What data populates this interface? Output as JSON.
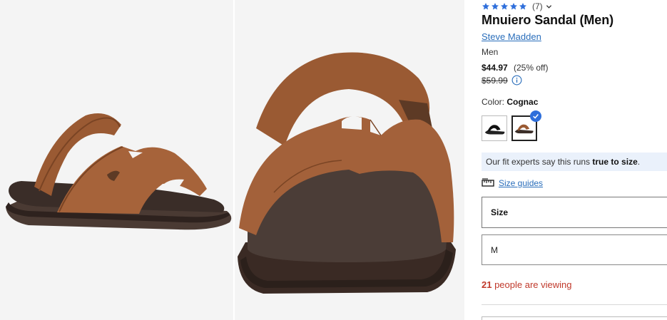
{
  "rating": {
    "stars": 5,
    "review_count": "(7)"
  },
  "product": {
    "title": "Mnuiero Sandal (Men)",
    "brand": "Steve Madden",
    "gender": "Men"
  },
  "pricing": {
    "sale_price": "$44.97",
    "discount": "(25% off)",
    "original_price": "$59.99"
  },
  "color": {
    "label": "Color:",
    "selected": "Cognac",
    "swatches": [
      "black",
      "cognac"
    ]
  },
  "fit": {
    "prefix": "Our fit experts say this runs ",
    "emphasis": "true to size",
    "suffix": "."
  },
  "size_guide": {
    "label": "Size guides"
  },
  "size": {
    "label": "Size",
    "selected": "M"
  },
  "viewing": {
    "count": "21",
    "text": " people are viewing"
  },
  "colors": {
    "link": "#2a6ebb",
    "star": "#2f6fdb",
    "alert": "#c0392b",
    "fit_bg": "#eaf1fb",
    "leather": "#9a5a33",
    "sole": "#3b2e28"
  }
}
